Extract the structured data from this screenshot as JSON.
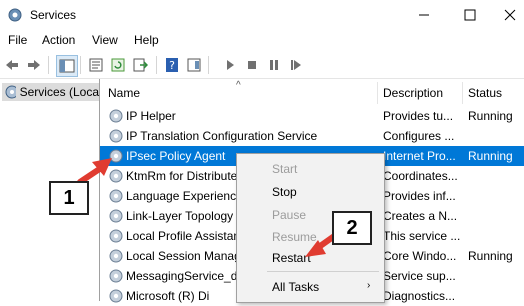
{
  "window": {
    "title": "Services"
  },
  "menu": [
    "File",
    "Action",
    "View",
    "Help"
  ],
  "tree": {
    "label": "Services (Loca"
  },
  "columns": {
    "name": "Name",
    "description": "Description",
    "status": "Status"
  },
  "rows": [
    {
      "name": "IP Helper",
      "description": "Provides tu...",
      "status": "Running"
    },
    {
      "name": "IP Translation Configuration Service",
      "description": "Configures ...",
      "status": ""
    },
    {
      "name": "IPsec Policy Agent",
      "description": "Internet Pro...",
      "status": "Running",
      "selected": true
    },
    {
      "name": "KtmRm for Distribute",
      "description": "Coordinates...",
      "status": ""
    },
    {
      "name": "Language Experience",
      "description": "Provides inf...",
      "status": ""
    },
    {
      "name": "Link-Layer Topology",
      "description": "Creates a N...",
      "status": ""
    },
    {
      "name": "Local Profile Assistan",
      "description": "This service ...",
      "status": ""
    },
    {
      "name": "Local Session Manag",
      "description": "Core Windo...",
      "status": "Running"
    },
    {
      "name": "MessagingService_db",
      "description": "Service sup...",
      "status": ""
    },
    {
      "name": "Microsoft (R) Di",
      "description": "Diagnostics...",
      "status": ""
    }
  ],
  "context_menu": {
    "items": [
      {
        "label": "Start",
        "disabled": true
      },
      {
        "label": "Stop",
        "disabled": false
      },
      {
        "label": "Pause",
        "disabled": true
      },
      {
        "label": "Resume",
        "disabled": true
      },
      {
        "label": "Restart",
        "disabled": false
      },
      {
        "label": "All Tasks",
        "disabled": false
      }
    ]
  },
  "annotations": {
    "step1": "1",
    "step2": "2"
  },
  "colors": {
    "selection": "#0078d7",
    "arrow": "#e03c31"
  }
}
